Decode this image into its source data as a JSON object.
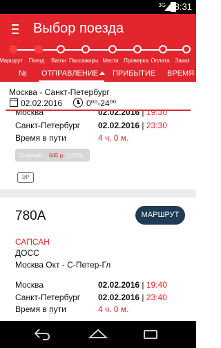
{
  "status_bar": {
    "time": "8:31",
    "signal": "3G"
  },
  "app_bar": {
    "title": "Выбор поезда"
  },
  "steps": [
    {
      "label": "Маршрут",
      "done": true
    },
    {
      "label": "Поезд",
      "done": true
    },
    {
      "label": "Вагон",
      "done": false
    },
    {
      "label": "Пассажиры",
      "done": false
    },
    {
      "label": "Места",
      "done": false
    },
    {
      "label": "Проверка",
      "done": false
    },
    {
      "label": "Оплата",
      "done": false
    },
    {
      "label": "Заказ",
      "done": false
    }
  ],
  "tabs": {
    "number": "№",
    "departure": "ОТПРАВЛЕНИЕ",
    "arrival": "ПРИБЫТИЕ",
    "travel_time": "ВРЕМЯ В"
  },
  "filter": {
    "route": "Москва - Санкт-Петербург",
    "date": "02.02.2016",
    "time_range": "0⁰⁰-24⁰⁰"
  },
  "train1": {
    "from_station": "Москва",
    "from_date": "02.02.2016",
    "from_time": "19:30",
    "to_station": "Санкт-Петербург",
    "to_date": "02.02.2016",
    "to_time": "23:30",
    "duration_label": "Время в пути",
    "duration": "4 ч. 0 м.",
    "seat_type": "Сидячий",
    "seat_price": "645 р.",
    "seat_count": "(1315)",
    "badge": "ЭР"
  },
  "train2": {
    "number": "780А",
    "route_button": "МАРШРУТ",
    "brand": "САПСАН",
    "class": "ДОСС",
    "route": "Москва Окт - С-Петер-Гл",
    "from_station": "Москва",
    "from_date": "02.02.2016",
    "from_time": "19:40",
    "to_station": "Санкт-Петербург",
    "to_date": "02.02.2016",
    "to_time": "23:40",
    "duration_label": "Время в пути",
    "duration": "4 ч. 0 м."
  },
  "separator": "|",
  "colors": {
    "primary": "#e3252d",
    "button_dark": "#1f3b55"
  },
  "icons": [
    "menu-icon",
    "calendar-icon",
    "clock-icon",
    "back-icon",
    "home-icon",
    "recent-apps-icon"
  ]
}
